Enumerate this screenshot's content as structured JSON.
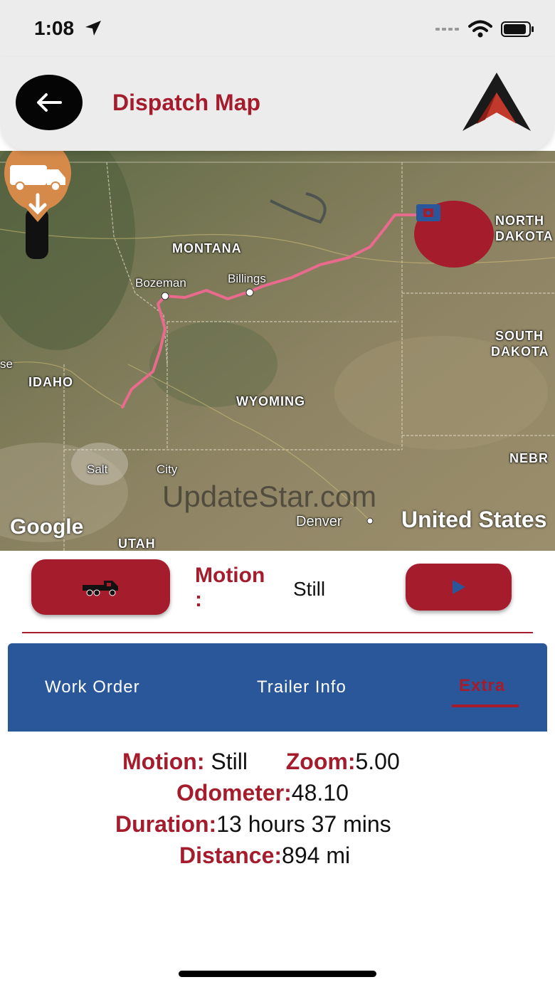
{
  "status_bar": {
    "time": "1:08"
  },
  "header": {
    "title": "Dispatch Map"
  },
  "map": {
    "labels": {
      "montana": "MONTANA",
      "north_dakota_1": "NORTH",
      "north_dakota_2": "DAKOTA",
      "south_dakota_1": "SOUTH",
      "south_dakota_2": "DAKOTA",
      "idaho": "IDAHO",
      "wyoming": "WYOMING",
      "utah": "UTAH",
      "nebraska": "NEBR",
      "edge": "se"
    },
    "cities": {
      "bozeman": "Bozeman",
      "billings": "Billings",
      "salt_lake_left": "Salt",
      "salt_lake_right": "City",
      "denver": "Denver"
    },
    "country": "United States",
    "google": "Google",
    "watermark": "UpdateStar.com"
  },
  "controls": {
    "motion_label": "Motion",
    "motion_colon": ":",
    "motion_value": "Still"
  },
  "tabs": [
    {
      "label": "Work Order"
    },
    {
      "label": "Trailer Info"
    },
    {
      "label": "Extra",
      "active": true
    }
  ],
  "info": {
    "motion_key": "Motion:",
    "motion_value": " Still",
    "zoom_key": "Zoom:",
    "zoom_value": "5.00",
    "odometer_key": "Odometer:",
    "odometer_value": "48.10",
    "duration_key": "Duration:",
    "duration_value": "13 hours 37 mins",
    "distance_key": "Distance:",
    "distance_value": "894 mi"
  },
  "colors": {
    "accent": "#a51c2d",
    "tabs_bg": "#2a5799",
    "route": "#e86a8c"
  }
}
